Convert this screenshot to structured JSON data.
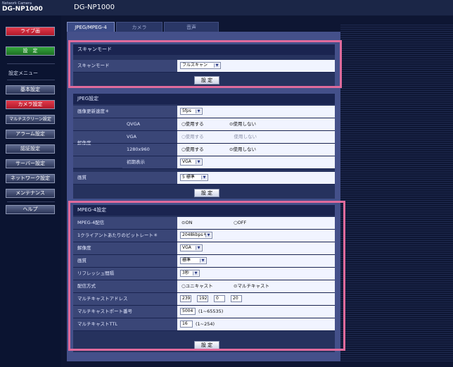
{
  "brand": {
    "line1": "Network Camera",
    "line2": "DG-NP1000"
  },
  "app_title": "DG-NP1000",
  "sidebar": {
    "live": "ライブ画",
    "setup": "設　定",
    "menu_label": "設定メニュー",
    "items": [
      "基本設定",
      "カメラ設定",
      "マルチスクリーン設定",
      "アラーム設定",
      "認証設定",
      "サーバー設定",
      "ネットワーク設定",
      "メンテナンス"
    ],
    "help": "ヘルプ"
  },
  "tabs": [
    "JPEG/MPEG-4",
    "カメラ",
    "音声"
  ],
  "scan": {
    "title": "スキャンモード",
    "label": "スキャンモード",
    "value": "フルスキャン",
    "button": "設 定"
  },
  "jpeg": {
    "title": "JPEG設定",
    "rate_label": "画像更新速度＊",
    "rate_value": "5fps",
    "res_label": "解像度",
    "rows": [
      {
        "name": "QVGA",
        "opt1": "使用する",
        "opt2": "使用しない",
        "selected": "opt2",
        "disabled": false
      },
      {
        "name": "VGA",
        "opt1": "使用する",
        "opt2": "使用しない",
        "selected": "none",
        "disabled": true
      },
      {
        "name": "1280x960",
        "opt1": "使用する",
        "opt2": "使用しない",
        "selected": "opt2",
        "disabled": false
      }
    ],
    "initial_label": "初期表示",
    "initial_value": "VGA",
    "quality_label": "画質",
    "quality_value": "5 標準",
    "button": "設 定"
  },
  "mpeg": {
    "title": "MPEG-4設定",
    "send_label": "MPEG-4配信",
    "on": "ON",
    "off": "OFF",
    "bitrate_label": "1クライアントあたりのビットレート＊",
    "bitrate_value": "2048kbps＊",
    "res_label": "解像度",
    "res_value": "VGA",
    "quality_label": "画質",
    "quality_value": "標準",
    "refresh_label": "リフレッシュ間隔",
    "refresh_value": "3秒",
    "method_label": "配信方式",
    "unicast": "ユニキャスト",
    "multicast": "マルチキャスト",
    "addr_label": "マルチキャストアドレス",
    "addr": [
      "239",
      "192",
      "0",
      "20"
    ],
    "port_label": "マルチキャストポート番号",
    "port": "5004",
    "port_range": "(1~65535)",
    "ttl_label": "マルチキャストTTL",
    "ttl": "16",
    "ttl_range": "(1~254)",
    "button": "設 定"
  },
  "colors": {
    "highlight": "#e06b9c",
    "panel": "#44508a",
    "background": "#0e1633"
  }
}
